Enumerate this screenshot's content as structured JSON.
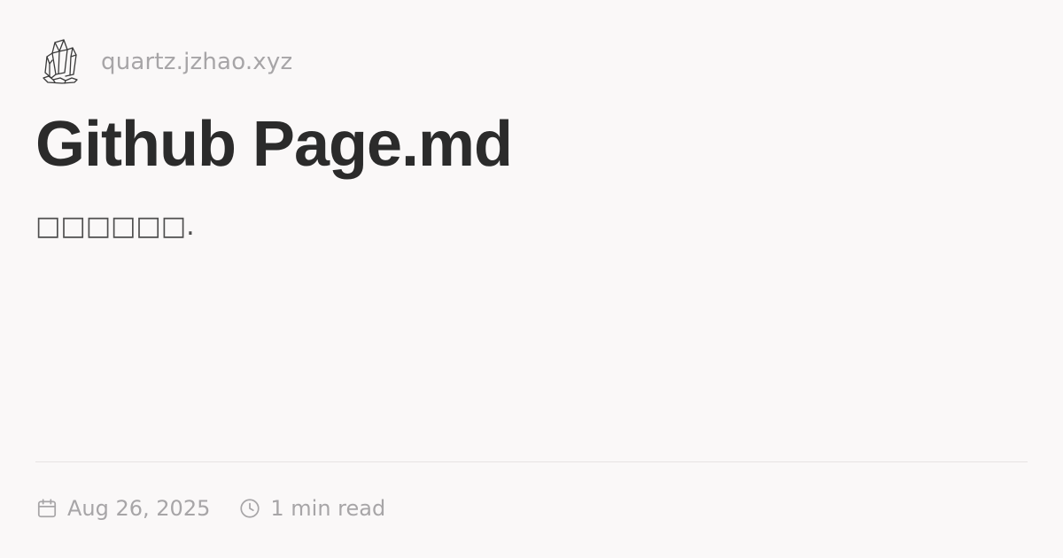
{
  "site": {
    "domain": "quartz.jzhao.xyz",
    "logo_icon": "crystal-logo-icon"
  },
  "page": {
    "title": "Github Page.md",
    "description": "□□□□□□."
  },
  "meta": {
    "date": "Aug 26, 2025",
    "date_icon": "calendar-icon",
    "reading_time": "1 min read",
    "reading_time_icon": "clock-icon"
  },
  "colors": {
    "background": "#faf8f8",
    "title": "#2b2b2b",
    "muted": "#a7a5a7",
    "divider": "#e6e3e3"
  }
}
